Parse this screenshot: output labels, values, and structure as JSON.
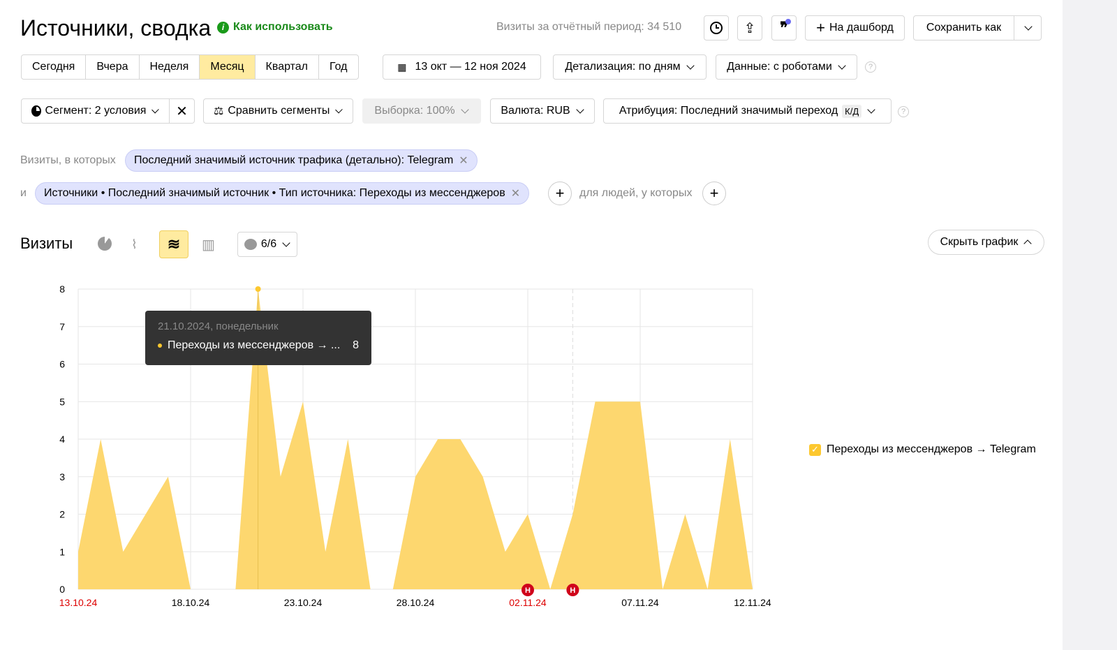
{
  "header": {
    "title": "Источники, сводка",
    "how_to": "Как использовать",
    "visits_period": "Визиты за отчётный период: 34 510",
    "to_dashboard": "На дашборд",
    "save_as": "Сохранить как"
  },
  "periods": [
    {
      "label": "Сегодня"
    },
    {
      "label": "Вчера"
    },
    {
      "label": "Неделя"
    },
    {
      "label": "Месяц",
      "active": true
    },
    {
      "label": "Квартал"
    },
    {
      "label": "Год"
    }
  ],
  "date_range": "13 окт — 12 ноя 2024",
  "detail": "Детализация: по дням",
  "data_robots": "Данные: с роботами",
  "segment": "Сегмент: 2 условия",
  "compare": "Сравнить сегменты",
  "sample": "Выборка: 100%",
  "currency": "Валюта: RUB",
  "attribution": "Атрибуция: Последний значимый переход",
  "attribution_badge": "К/Д",
  "filters": {
    "visits_where": "Визиты, в которых",
    "chip1": "Последний значимый источник трафика (детально): Telegram",
    "and": "и",
    "chip2": "Источники • Последний значимый источник • Тип источника: Переходы из мессенджеров",
    "people_where": "для людей, у которых"
  },
  "chart_section": {
    "title": "Визиты",
    "series_count": "6/6",
    "hide_chart": "Скрыть график",
    "accent": "#ffeba0"
  },
  "tooltip": {
    "date": "21.10.2024, понедельник",
    "series": "Переходы из мессенджеров → ...",
    "value": "8"
  },
  "chart_data": {
    "type": "area",
    "x": [
      "13.10.24",
      "14.10.24",
      "15.10.24",
      "16.10.24",
      "17.10.24",
      "18.10.24",
      "19.10.24",
      "20.10.24",
      "21.10.24",
      "22.10.24",
      "23.10.24",
      "24.10.24",
      "25.10.24",
      "26.10.24",
      "27.10.24",
      "28.10.24",
      "29.10.24",
      "30.10.24",
      "31.10.24",
      "01.11.24",
      "02.11.24",
      "03.11.24",
      "04.11.24",
      "05.11.24",
      "06.11.24",
      "07.11.24",
      "08.11.24",
      "09.11.24",
      "10.11.24",
      "11.11.24",
      "12.11.24"
    ],
    "series": [
      {
        "name": "Переходы из мессенджеров → Telegram",
        "color": "#fdd76f",
        "values": [
          1,
          4,
          1,
          2,
          3,
          0,
          0,
          0,
          8,
          3,
          5,
          1,
          4,
          0,
          0,
          3,
          4,
          4,
          3,
          1,
          2,
          0,
          2,
          5,
          5,
          5,
          0,
          2,
          0,
          4,
          0
        ]
      }
    ],
    "xticks": [
      {
        "label": "13.10.24",
        "holiday": true,
        "index": 0
      },
      {
        "label": "18.10.24",
        "index": 5
      },
      {
        "label": "23.10.24",
        "index": 10
      },
      {
        "label": "28.10.24",
        "index": 15
      },
      {
        "label": "02.11.24",
        "holiday": true,
        "index": 20
      },
      {
        "label": "07.11.24",
        "index": 25
      },
      {
        "label": "12.11.24",
        "index": 30
      }
    ],
    "yticks": [
      "0",
      "1",
      "2",
      "3",
      "4",
      "5",
      "6",
      "7",
      "8"
    ],
    "ylim": [
      0,
      8
    ],
    "grid": true,
    "legend": "right",
    "annotations": [
      {
        "index": 20,
        "label": "Н"
      },
      {
        "index": 22,
        "label": "Н"
      }
    ],
    "highlight_index": 8
  }
}
